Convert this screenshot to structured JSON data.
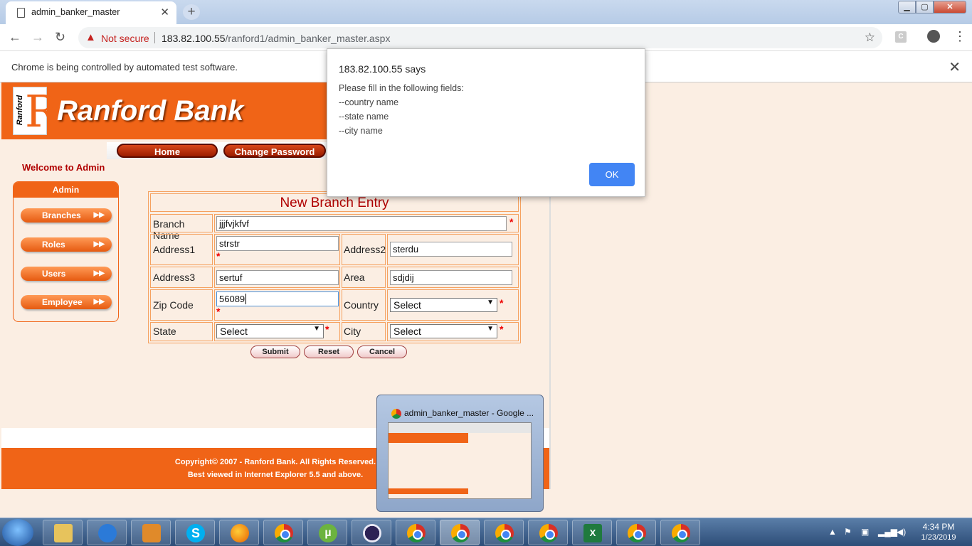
{
  "browser": {
    "tab_title": "admin_banker_master",
    "not_secure": "Not secure",
    "url_host": "183.82.100.55",
    "url_path": "/ranford1/admin_banker_master.aspx",
    "infobar": "Chrome is being controlled by automated test software."
  },
  "site": {
    "bank_name": "Ranford Bank",
    "logo_text": "Ranford",
    "nav": {
      "home": "Home",
      "change_password": "Change Password"
    },
    "welcome": "Welcome to Admin",
    "sidebar": {
      "title": "Admin",
      "items": [
        {
          "label": "Branches"
        },
        {
          "label": "Roles"
        },
        {
          "label": "Users"
        },
        {
          "label": "Employee"
        }
      ]
    },
    "form": {
      "title": "New Branch Entry",
      "branch_name_label": "Branch Name",
      "branch_name_value": "jjjfvjkfvf",
      "address1_label": "Address1",
      "address1_value": "strstr",
      "address2_label": "Address2",
      "address2_value": "sterdu",
      "address3_label": "Address3",
      "address3_value": "sertuf",
      "area_label": "Area",
      "area_value": "sdjdij",
      "zip_label": "Zip Code",
      "zip_value": "56089",
      "country_label": "Country",
      "country_value": "Select",
      "state_label": "State",
      "state_value": "Select",
      "city_label": "City",
      "city_value": "Select",
      "required_mark": "*",
      "submit": "Submit",
      "reset": "Reset",
      "cancel": "Cancel"
    },
    "footer": {
      "line1": "Copyright© 2007 - Ranford Bank. All Rights Reserved.",
      "line2": "Best viewed in Internet Explorer 5.5 and above."
    }
  },
  "alert": {
    "title": "183.82.100.55 says",
    "lines": [
      "Please fill in the following fields:",
      "--country name",
      "--state name",
      "--city name"
    ],
    "ok": "OK"
  },
  "preview": {
    "title": "admin_banker_master - Google ..."
  },
  "taskbar": {
    "time": "4:34 PM",
    "date": "1/23/2019"
  },
  "colors": {
    "brand_orange": "#f06417",
    "brand_red": "#b00000",
    "page_bg": "#fbeee3",
    "ok_blue": "#4285f4"
  }
}
